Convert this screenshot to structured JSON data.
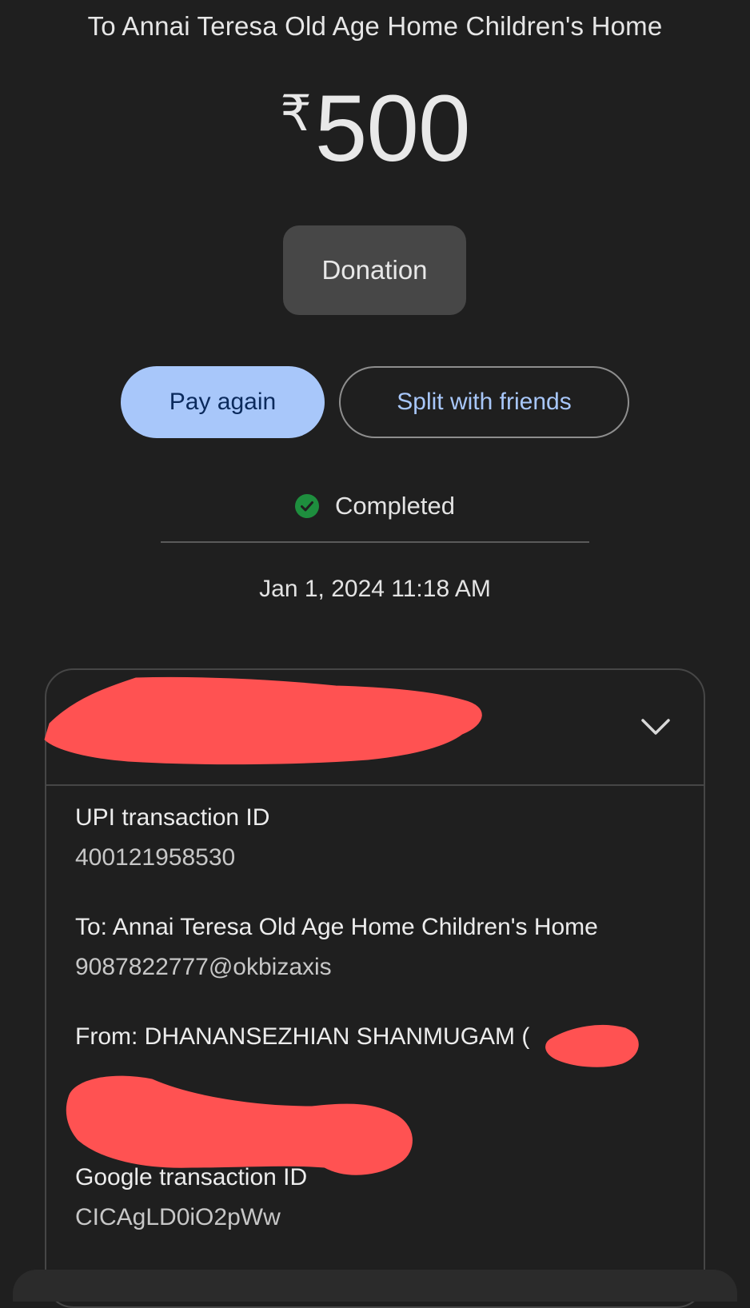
{
  "header": {
    "title": "To Annai Teresa Old Age Home Children's Home"
  },
  "payment": {
    "currency_symbol": "₹",
    "amount": "500",
    "note": "Donation",
    "status": "Completed",
    "status_color": "#1e8e3e",
    "datetime": "Jan 1, 2024 11:18 AM"
  },
  "actions": {
    "pay_again": "Pay again",
    "split": "Split with friends"
  },
  "details": {
    "upi_label": "UPI transaction ID",
    "upi_value": "400121958530",
    "to_label": "To: Annai Teresa Old Age Home Children's Home",
    "to_value": "9087822777@okbizaxis",
    "from_label": "From: DHANANSEZHIAN SHANMUGAM (",
    "google_label": "Google transaction ID",
    "google_value": "CICAgLD0iO2pWw"
  },
  "icons": {
    "status": "check-circle-icon",
    "expand": "chevron-down-icon"
  },
  "colors": {
    "background": "#1f1f1f",
    "primary_button": "#a8c7fa",
    "redaction": "#ff5252"
  }
}
